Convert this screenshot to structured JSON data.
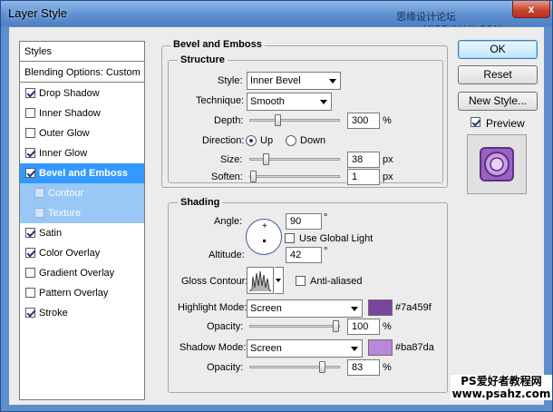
{
  "window": {
    "title": "Layer Style",
    "watermark_top": "思缘设计论坛 www.MISSVUAN.COM",
    "close_label": "x"
  },
  "styles_panel": {
    "header": "Styles",
    "blending": "Blending Options: Custom",
    "items": [
      {
        "label": "Drop Shadow",
        "checked": true
      },
      {
        "label": "Inner Shadow",
        "checked": false
      },
      {
        "label": "Outer Glow",
        "checked": false
      },
      {
        "label": "Inner Glow",
        "checked": true
      },
      {
        "label": "Bevel and Emboss",
        "checked": true,
        "selected": true
      },
      {
        "label": "Contour",
        "checked": false,
        "sub": true
      },
      {
        "label": "Texture",
        "checked": false,
        "sub": true
      },
      {
        "label": "Satin",
        "checked": true
      },
      {
        "label": "Color Overlay",
        "checked": true
      },
      {
        "label": "Gradient Overlay",
        "checked": false
      },
      {
        "label": "Pattern Overlay",
        "checked": false
      },
      {
        "label": "Stroke",
        "checked": true
      }
    ]
  },
  "bevel": {
    "section_title": "Bevel and Emboss",
    "structure_title": "Structure",
    "style_label": "Style:",
    "style_value": "Inner Bevel",
    "technique_label": "Technique:",
    "technique_value": "Smooth",
    "depth_label": "Depth:",
    "depth_value": "300",
    "depth_unit": "%",
    "depth_level": 0.3,
    "direction_label": "Direction:",
    "dir_up": "Up",
    "dir_down": "Down",
    "direction_selected": "Up",
    "size_label": "Size:",
    "size_value": "38",
    "size_unit": "px",
    "size_level": 0.15,
    "soften_label": "Soften:",
    "soften_value": "1",
    "soften_unit": "px",
    "soften_level": 0.0
  },
  "shading": {
    "title": "Shading",
    "angle_label": "Angle:",
    "angle_value": "90",
    "angle_unit": "°",
    "global_light_label": "Use Global Light",
    "global_light_checked": false,
    "altitude_label": "Altitude:",
    "altitude_value": "42",
    "altitude_unit": "°",
    "gloss_label": "Gloss Contour:",
    "antialias_label": "Anti-aliased",
    "antialias_checked": false,
    "highlight_label": "Highlight Mode:",
    "highlight_mode": "Screen",
    "highlight_color": "#7a459f",
    "highlight_hex": "#7a459f",
    "hl_opacity_label": "Opacity:",
    "hl_opacity_value": "100",
    "hl_opacity_unit": "%",
    "hl_opacity_level": 1.0,
    "shadow_label": "Shadow Mode:",
    "shadow_mode": "Screen",
    "shadow_color": "#ba87da",
    "shadow_hex": "#ba87da",
    "sh_opacity_label": "Opacity:",
    "sh_opacity_value": "83",
    "sh_opacity_unit": "%",
    "sh_opacity_level": 0.83
  },
  "buttons": {
    "ok": "OK",
    "reset": "Reset",
    "new_style": "New Style...",
    "preview_label": "Preview",
    "preview_checked": true
  },
  "watermark_bottom": {
    "line1": "PS爱好者教程网",
    "line2": "www.psahz.com"
  }
}
